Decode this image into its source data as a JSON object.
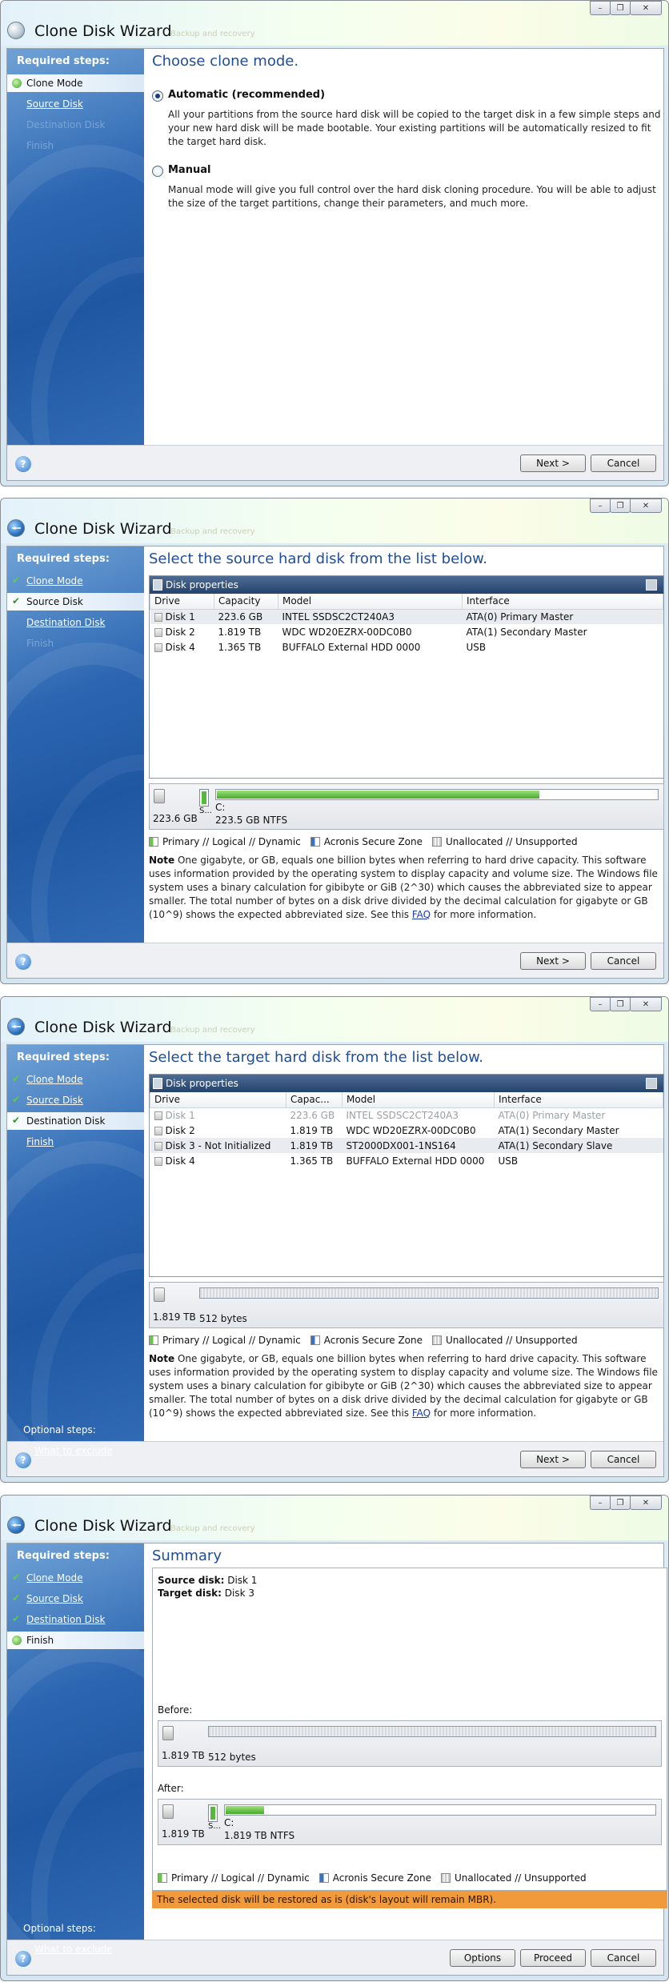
{
  "common": {
    "title": "Clone Disk Wizard",
    "ghost_text": "Backup and recovery",
    "required_steps": "Required steps:",
    "optional_steps": "Optional steps:",
    "what_to_exclude": "What to exclude",
    "help": "?",
    "next": "Next >",
    "cancel": "Cancel",
    "options": "Options",
    "proceed": "Proceed",
    "minimize": "–",
    "restore": "❐",
    "close": "✕",
    "steps": [
      "Clone Mode",
      "Source Disk",
      "Destination Disk",
      "Finish"
    ],
    "disk_properties": "Disk properties",
    "legend": {
      "primary": "Primary // Logical // Dynamic",
      "acronis": "Acronis Secure Zone",
      "unalloc": "Unallocated // Unsupported"
    },
    "note": {
      "bold": "Note",
      "text": " One gigabyte, or GB, equals one billion bytes when referring to hard drive capacity. This software uses information provided by the operating system to display capacity and volume size. The Windows file system uses a binary calculation for gibibyte or GiB (2^30) which causes the abbreviated size to appear smaller.  The total number of bytes on a disk drive divided by the decimal calculation for gigabyte or GB (10^9) shows the expected abbreviated size. See this ",
      "link": "FAQ",
      "tail": " for more information."
    }
  },
  "screen1": {
    "heading": "Choose clone mode.",
    "auto_label": "Automatic (recommended)",
    "auto_desc": "All your partitions from the source hard disk will be copied to the target disk in a few simple steps and your new hard disk will be made bootable. Your existing partitions will be automatically resized to fit the target hard disk.",
    "manual_label": "Manual",
    "manual_desc": "Manual mode will give you full control over the hard disk cloning procedure. You will be able to adjust the size of the target partitions, change their parameters, and much more.",
    "selected": "auto"
  },
  "screen2": {
    "heading": "Select the source hard disk from the list below.",
    "columns": [
      "Drive",
      "Capacity",
      "Model",
      "Interface"
    ],
    "rows": [
      {
        "drive": "Disk 1",
        "capacity": "223.6 GB",
        "model": "INTEL SSDSC2CT240A3",
        "iface": "ATA(0) Primary Master"
      },
      {
        "drive": "Disk 2",
        "capacity": "1.819 TB",
        "model": "WDC WD20EZRX-00DC0B0",
        "iface": "ATA(1) Secondary Master"
      },
      {
        "drive": "Disk 4",
        "capacity": "1.365 TB",
        "model": "BUFFALO External HDD 0000",
        "iface": "USB"
      }
    ],
    "map": {
      "size": "223.6 GB",
      "frag": "S...",
      "part_name": "C:",
      "part_info": "223.5 GB  NTFS",
      "used_fraction": 0.73
    }
  },
  "screen3": {
    "heading": "Select the target hard disk from the list below.",
    "columns": [
      "Drive",
      "Capac...",
      "Model",
      "Interface"
    ],
    "rows": [
      {
        "drive": "Disk 1",
        "capacity": "223.6 GB",
        "model": "INTEL SSDSC2CT240A3",
        "iface": "ATA(0) Primary Master"
      },
      {
        "drive": "Disk 2",
        "capacity": "1.819 TB",
        "model": "WDC WD20EZRX-00DC0B0",
        "iface": "ATA(1) Secondary Master"
      },
      {
        "drive": "Disk 3 - Not Initialized",
        "capacity": "1.819 TB",
        "model": "ST2000DX001-1NS164",
        "iface": "ATA(1) Secondary Slave"
      },
      {
        "drive": "Disk 4",
        "capacity": "1.365 TB",
        "model": "BUFFALO External HDD 0000",
        "iface": "USB"
      }
    ],
    "map": {
      "size": "1.819 TB",
      "bytes": "512 bytes"
    }
  },
  "screen4": {
    "heading": "Summary",
    "source_label": "Source disk:",
    "source_value": " Disk 1",
    "target_label": "Target disk:",
    "target_value": " Disk 3",
    "before": "Before:",
    "after": "After:",
    "before_map": {
      "size": "1.819 TB",
      "bytes": "512 bytes"
    },
    "after_map": {
      "size": "1.819 TB",
      "frag": "S...",
      "part_name": "C:",
      "part_info": "1.819 TB  NTFS",
      "used_fraction": 0.09
    },
    "banner": "The selected disk will be restored as is (disk's layout will remain MBR)."
  }
}
